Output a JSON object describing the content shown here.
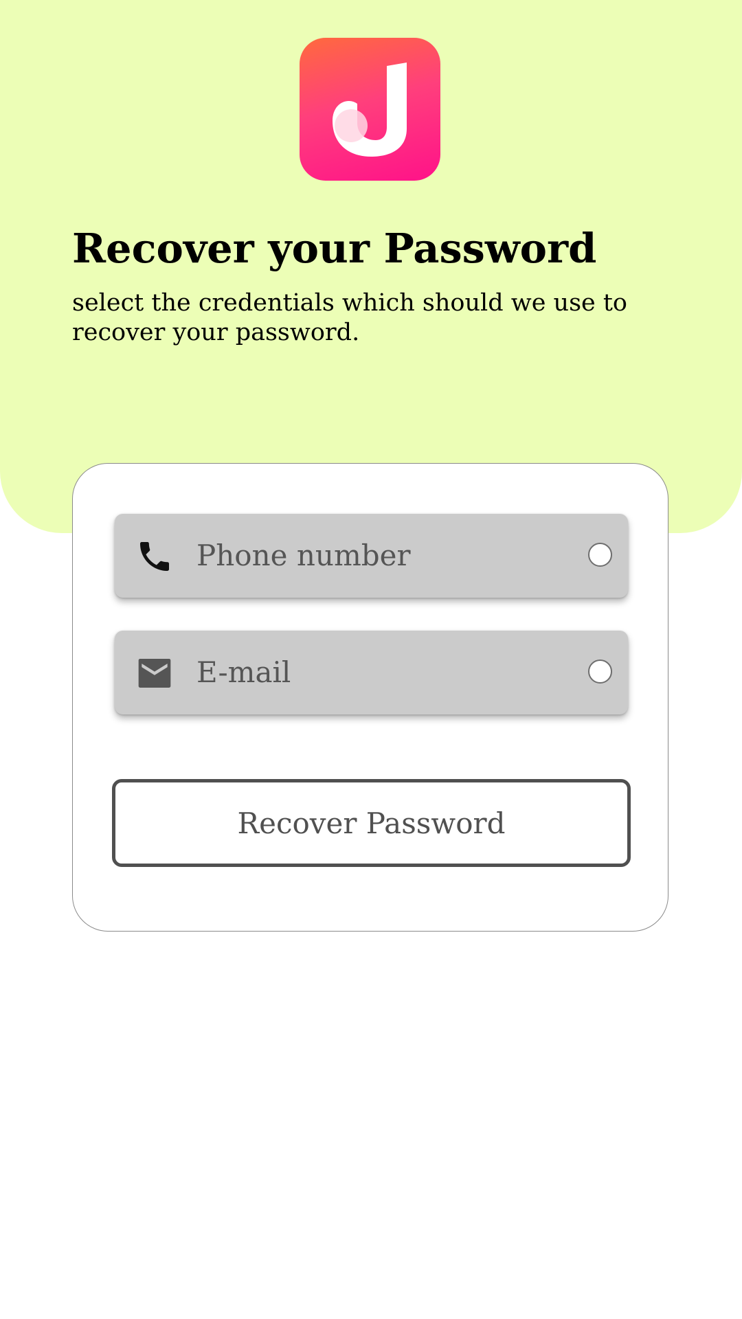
{
  "colors": {
    "top_background": "#ecfeb6",
    "logo_gradient_start": "#ff6a3d",
    "logo_gradient_end": "#ff1289",
    "option_background": "#cbcbcb",
    "button_border": "#505050"
  },
  "header": {
    "logo_icon": "app-logo-icon",
    "title": "Recover your Password",
    "subtitle": "select the credentials which should we use to recover your password."
  },
  "options": [
    {
      "icon": "phone-icon",
      "label": "Phone number",
      "selected": false
    },
    {
      "icon": "mail-icon",
      "label": "E-mail",
      "selected": false
    }
  ],
  "recover_button": {
    "label": "Recover Password"
  }
}
